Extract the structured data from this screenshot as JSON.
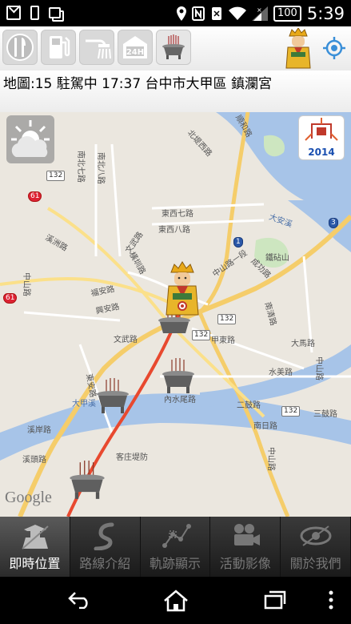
{
  "status_bar": {
    "time": "5:39",
    "battery": "100",
    "left_icons": [
      "mail-icon",
      "phone-icon",
      "copy-icon"
    ],
    "right_icons": [
      "location-icon",
      "nfc-icon",
      "vibrate-icon",
      "wifi-icon",
      "signal-icon",
      "battery-icon"
    ]
  },
  "toolbar": {
    "buttons": [
      "utensils-icon",
      "gas-pump-icon",
      "shower-icon",
      "24h-icon",
      "incense-burner-icon"
    ],
    "badge_24h": "24H",
    "right": [
      "goddess-avatar-icon",
      "locate-icon"
    ]
  },
  "info": {
    "text": "地圖:15  駐駕中 17:37 台中市大甲區 鎮瀾宮"
  },
  "map": {
    "weather_icon": "sun-cloud-icon",
    "year_badge": "2014",
    "attribution": "Google",
    "road_labels": [
      {
        "text": "北堤西路"
      },
      {
        "text": "順和路"
      },
      {
        "text": "文武路"
      },
      {
        "text": "大安溪"
      },
      {
        "text": "南北七路"
      },
      {
        "text": "南北八路"
      },
      {
        "text": "東西七路"
      },
      {
        "text": "東西八路"
      },
      {
        "text": "溪洲路"
      },
      {
        "text": "中山路"
      },
      {
        "text": "鐵砧山"
      },
      {
        "text": "橫圳路"
      },
      {
        "text": "成功路"
      },
      {
        "text": "中山路一段"
      },
      {
        "text": "福安路"
      },
      {
        "text": "興安路"
      },
      {
        "text": "文武路"
      },
      {
        "text": "甲東路"
      },
      {
        "text": "大馬路"
      },
      {
        "text": "南清路"
      },
      {
        "text": "東安路"
      },
      {
        "text": "大甲溪"
      },
      {
        "text": "內水尾路"
      },
      {
        "text": "二鼓路"
      },
      {
        "text": "水美路"
      },
      {
        "text": "中山路"
      },
      {
        "text": "三鼓路"
      },
      {
        "text": "溪岸路"
      },
      {
        "text": "溪頭路"
      },
      {
        "text": "客庄堤防"
      },
      {
        "text": "南日路"
      },
      {
        "text": "中山路"
      }
    ],
    "shields": [
      "132",
      "61",
      "132",
      "1",
      "3",
      "61",
      "132",
      "132",
      "132"
    ]
  },
  "bottom_nav": {
    "items": [
      {
        "label": "即時位置",
        "icon": "goddess-location-icon",
        "active": true
      },
      {
        "label": "路線介紹",
        "icon": "route-icon",
        "active": false
      },
      {
        "label": "軌跡顯示",
        "icon": "track-icon",
        "active": false
      },
      {
        "label": "活動影像",
        "icon": "video-camera-icon",
        "active": false
      },
      {
        "label": "關於我們",
        "icon": "about-eye-icon",
        "active": false
      }
    ]
  },
  "system_nav": [
    "back-icon",
    "home-icon",
    "recents-icon",
    "more-icon"
  ]
}
